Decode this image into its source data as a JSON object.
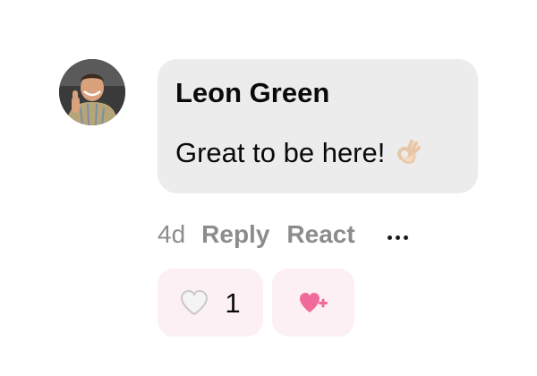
{
  "comment": {
    "author": "Leon Green",
    "text": "Great to be here!",
    "emoji": "ok-hand-icon"
  },
  "meta": {
    "age": "4d",
    "reply_label": "Reply",
    "react_label": "React",
    "more_icon": "more-dots-icon"
  },
  "reactions": {
    "heart_icon": "white-heart-icon",
    "heart_count": "1",
    "add_icon": "heart-plus-icon",
    "accent_color": "#f06a9a",
    "pill_color": "#fdf0f4"
  },
  "colors": {
    "bubble": "#ececec",
    "meta_text": "#8c8c8c",
    "text": "#0a0a0a"
  }
}
